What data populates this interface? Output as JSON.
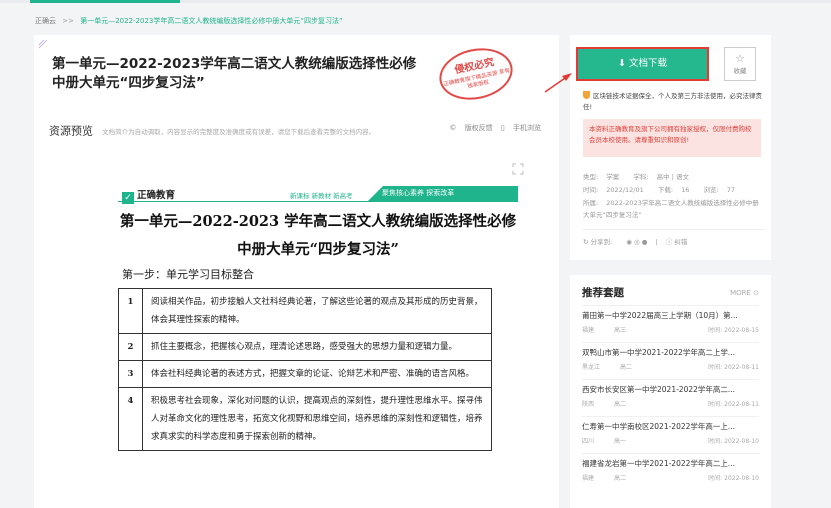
{
  "breadcrumb": {
    "home": "正确云",
    "separator": ">>",
    "current": "第一单元—2022-2023学年高二语文人教统编版选择性必修中册大单元“四步复习法”"
  },
  "document": {
    "title": "第一单元—2022-2023学年高二语文人教统编版选择性必修中册大单元“四步复习法”",
    "stamp_title": "侵权必究",
    "stamp_text": "正确教育旗下精品资源 享有独家版权"
  },
  "preview": {
    "label": "资源预览",
    "hint": "文档简介为自动调取，内容显示的完整度及准确度或有误差，请您下载后查看完整的文档内容。",
    "copyright_feedback": "版权反馈",
    "mobile_view": "手机浏览"
  },
  "page": {
    "brand": "正确教育",
    "tags": "新课标 新教材 新高考",
    "banner": "聚焦核心素养 探索改革",
    "title_line1": "第一单元—2022-2023 学年高二语文人教统编版选择性必修",
    "title_line2": "中册大单元“四步复习法”",
    "step1": "第一步：单元学习目标整合",
    "goals": [
      {
        "num": "1",
        "text": "阅读相关作品，初步接触人文社科经典论著，了解这些论著的观点及其形成的历史背景，体会其理性探索的精神。"
      },
      {
        "num": "2",
        "text": "抓住主要概念，把握核心观点，理清论述思路，感受强大的思想力量和逻辑力量。"
      },
      {
        "num": "3",
        "text": "体会社科经典论著的表述方式，把握文章的论证、论辩艺术和严密、准确的语言风格。"
      },
      {
        "num": "4",
        "text": "积极思考社会现象，深化对问题的认识，提高观点的深刻性，提升理性思维水平。探寻伟人对革命文化的理性思考，拓宽文化视野和思维空间，培养思维的深刻性和逻辑性，培养求真求实的科学态度和勇于探索创新的精神。"
      }
    ]
  },
  "download": {
    "button": "⬇ 文档下载",
    "favorite": "收藏",
    "blockchain": "区块链技术证据保全，个人及第三方非法使用，必究法律责任!",
    "notice": "本资料正确教育及旗下公司拥有独家授权，仅限付费购校会员本校使用。请尊重知识和原创!",
    "meta": {
      "type_label": "类型:",
      "type_value": "学案",
      "subject_label": "学科:",
      "subject_value": "高中 | 语文",
      "time_label": "时间:",
      "time_value": "2022/12/01",
      "downloads_label": "下载:",
      "downloads_value": "16",
      "views_label": "浏览:",
      "views_value": "77",
      "belongs_label": "所属:",
      "belongs_value": "2022-2023学年高二语文人教统编版选择性必修中册大单元“四步复习法”"
    },
    "share_label": "分享到:",
    "report": "纠错"
  },
  "recommend": {
    "title": "推荐套题",
    "more": "MORE",
    "time_label": "时间:",
    "items": [
      {
        "title": "莆田第一中学2022届高三上学期（10月）第...",
        "region": "福建",
        "grade": "高三",
        "date": "2022-08-15"
      },
      {
        "title": "双鸭山市第一中学2021-2022学年高二上学...",
        "region": "黑龙江",
        "grade": "高二",
        "date": "2022-08-11"
      },
      {
        "title": "西安市长安区第一中学2021-2022学年高二...",
        "region": "陕西",
        "grade": "高二",
        "date": "2022-08-11"
      },
      {
        "title": "仁寿第一中学南校区2021-2022学年高一上...",
        "region": "四川",
        "grade": "高一",
        "date": "2022-08-10"
      },
      {
        "title": "福建省龙岩第一中学2021-2022学年高二上...",
        "region": "福建",
        "grade": "高二",
        "date": "2022-08-10"
      }
    ]
  },
  "colors": {
    "accent": "#1fb48b",
    "button": "#25b88e",
    "highlight": "#e23a36",
    "notice_bg": "#fbe3e1"
  }
}
